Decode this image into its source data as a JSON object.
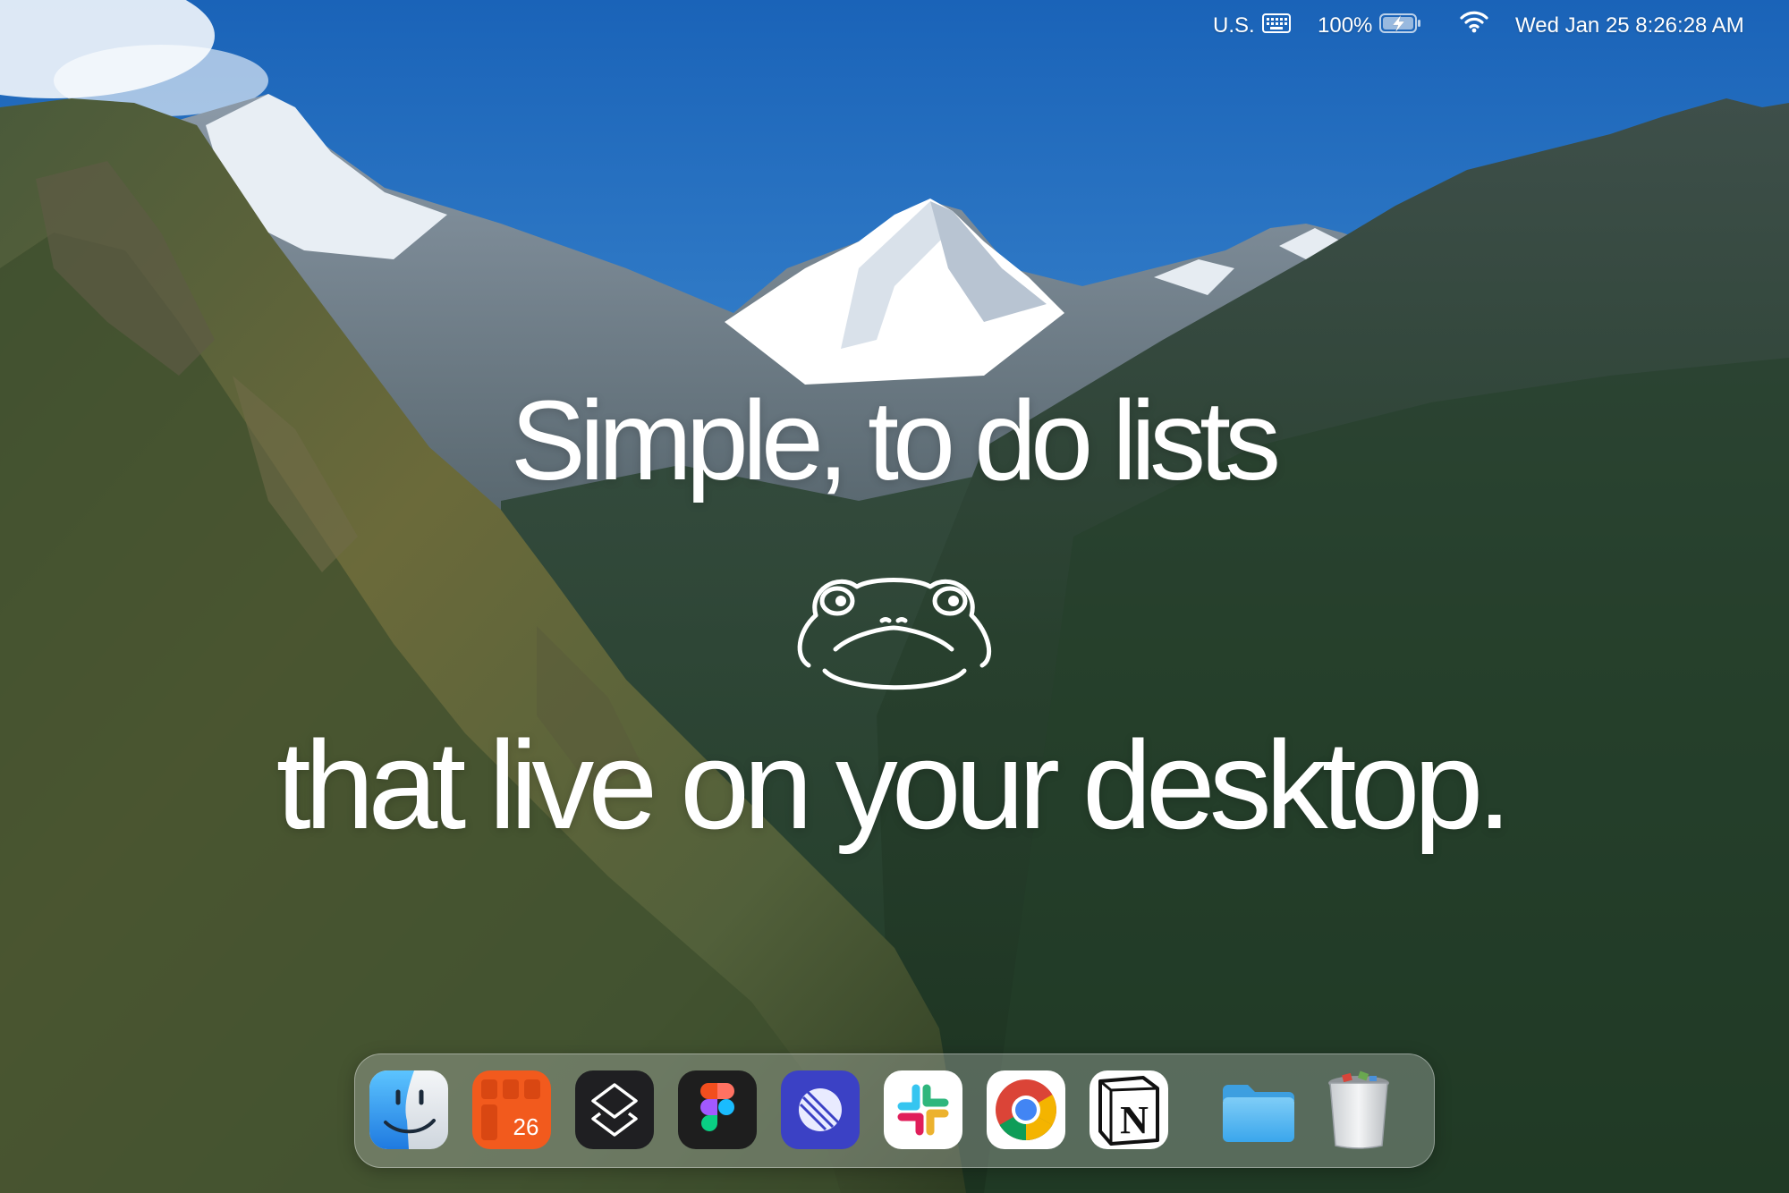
{
  "menubar": {
    "input_source": "U.S.",
    "battery_percent": "100%",
    "battery_level": 1.0,
    "battery_charging": true,
    "clock": "Wed Jan 25 8:26:28 AM",
    "icons": [
      "keyboard-icon",
      "battery-charging-icon",
      "wifi-icon"
    ]
  },
  "hero": {
    "line1": "Simple, to do lists",
    "line2": "that live on your desktop.",
    "mascot": "frog-face-icon"
  },
  "dock": {
    "apps": [
      {
        "icon": "finder-icon"
      },
      {
        "icon": "fantastical-calendar-icon",
        "badge_text": "26"
      },
      {
        "icon": "stack-layers-icon"
      },
      {
        "icon": "figma-icon"
      },
      {
        "icon": "linear-icon"
      },
      {
        "icon": "slack-icon"
      },
      {
        "icon": "chrome-icon"
      },
      {
        "icon": "notion-icon",
        "letter": "N"
      },
      {
        "icon": "folder-icon"
      },
      {
        "icon": "trash-icon"
      }
    ]
  },
  "colors": {
    "sky_top": "#1f6fc4",
    "sky_bottom": "#5aa0d8",
    "text": "#ffffff",
    "calendar_orange": "#f25a1d",
    "linear_blue": "#3b41c5"
  }
}
